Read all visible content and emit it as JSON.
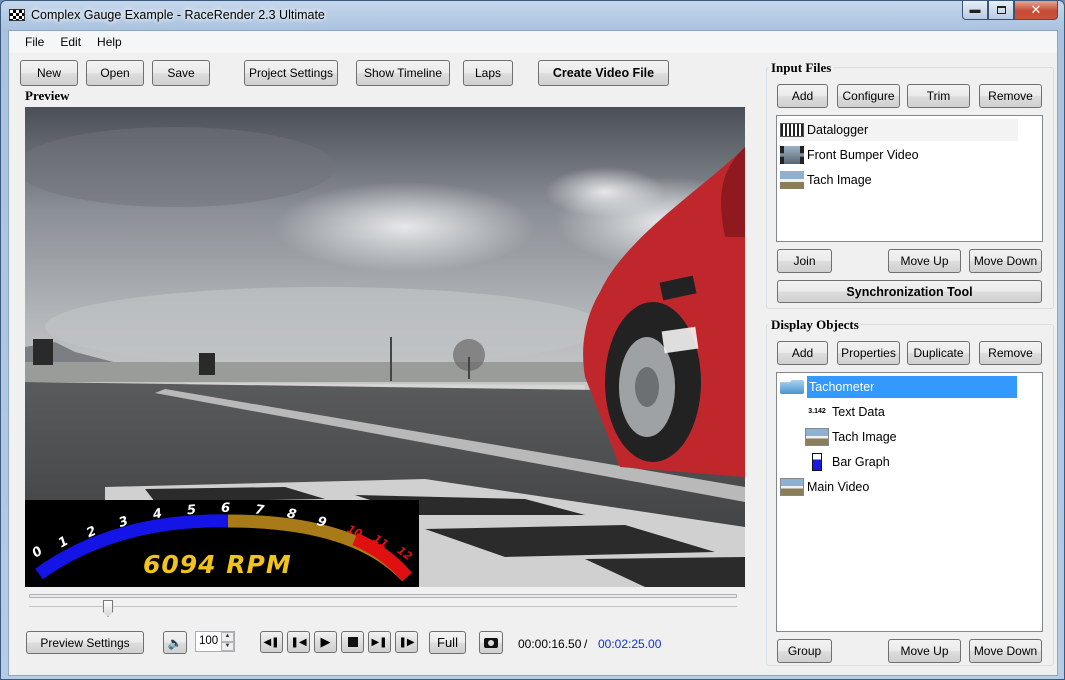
{
  "window": {
    "title": "Complex Gauge Example - RaceRender 2.3 Ultimate"
  },
  "menu": [
    "File",
    "Edit",
    "Help"
  ],
  "toolbar": {
    "new": "New",
    "open": "Open",
    "save": "Save",
    "project_settings": "Project Settings",
    "show_timeline": "Show Timeline",
    "laps": "Laps",
    "create_video": "Create Video File"
  },
  "preview": {
    "label": "Preview",
    "gauge": {
      "rpm_text": "6094 RPM",
      "ticks": [
        "0",
        "1",
        "2",
        "3",
        "4",
        "5",
        "6",
        "7",
        "8",
        "9",
        "10",
        "11",
        "12"
      ],
      "fraction": 0.5
    }
  },
  "input_files": {
    "label": "Input Files",
    "buttons": {
      "add": "Add",
      "configure": "Configure",
      "trim": "Trim",
      "remove": "Remove"
    },
    "items": [
      {
        "label": "Datalogger",
        "icon": "datalogger-icon"
      },
      {
        "label": "Front Bumper Video",
        "icon": "video-file-icon"
      },
      {
        "label": "Tach Image",
        "icon": "image-file-icon"
      }
    ],
    "lower_buttons": {
      "join": "Join",
      "move_up": "Move Up",
      "move_down": "Move Down"
    },
    "sync_tool": "Synchronization Tool"
  },
  "display_objects": {
    "label": "Display Objects",
    "buttons": {
      "add": "Add",
      "properties": "Properties",
      "duplicate": "Duplicate",
      "remove": "Remove"
    },
    "items": [
      {
        "label": "Tachometer",
        "icon": "folder-icon"
      },
      {
        "label": "Text Data",
        "icon": "text-data-icon",
        "icon_text": "3.142"
      },
      {
        "label": "Tach Image",
        "icon": "image-object-icon"
      },
      {
        "label": "Bar Graph",
        "icon": "bar-graph-icon"
      },
      {
        "label": "Main Video",
        "icon": "video-object-icon"
      }
    ],
    "lower_buttons": {
      "group": "Group",
      "move_up": "Move Up",
      "move_down": "Move Down"
    }
  },
  "playback": {
    "preview_settings": "Preview Settings",
    "volume": "100",
    "full": "Full",
    "current_time": "00:00:16.50",
    "separator": "/",
    "total_time": "00:02:25.00",
    "position_fraction": 0.114
  },
  "colors": {
    "selection": "#3399ff",
    "total_time": "#1234c8",
    "rpm_text": "#f2c31a",
    "gauge_blue": "#1414e6",
    "gauge_gold": "#a87a18",
    "redline": "#e01010"
  }
}
